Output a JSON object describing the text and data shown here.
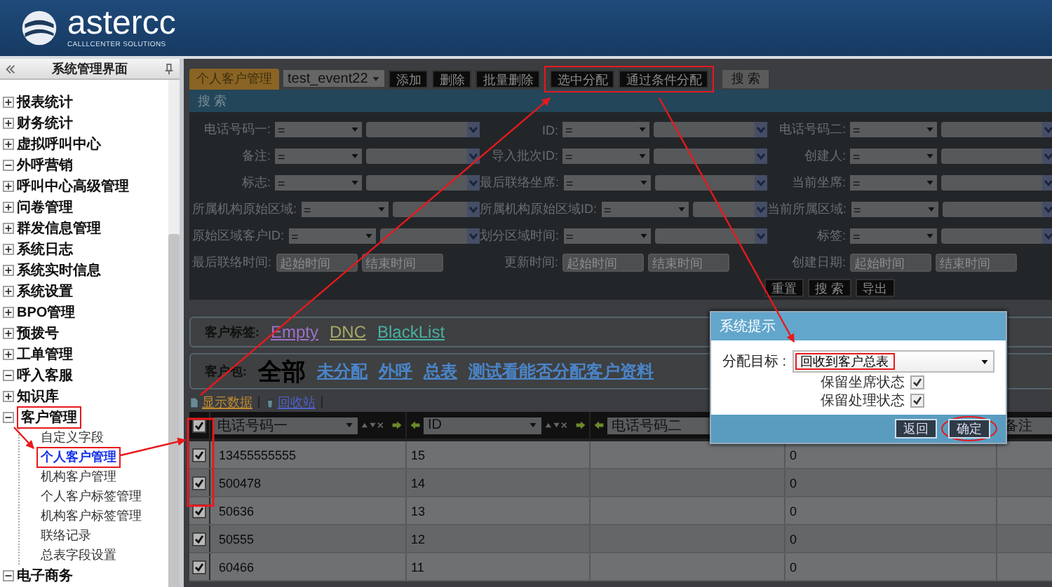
{
  "header": {
    "brand": "astercc",
    "tagline": "CALLLCENTER SOLUTIONS"
  },
  "sidebar": {
    "title": "系统管理界面",
    "items": [
      {
        "label": "报表统计",
        "expanded": false,
        "highlighted": false
      },
      {
        "label": "财务统计",
        "expanded": false,
        "highlighted": false
      },
      {
        "label": "虚拟呼叫中心",
        "expanded": false,
        "highlighted": false
      },
      {
        "label": "外呼营销",
        "expanded": true,
        "highlighted": false
      },
      {
        "label": "呼叫中心高级管理",
        "expanded": false,
        "highlighted": false
      },
      {
        "label": "问卷管理",
        "expanded": false,
        "highlighted": false
      },
      {
        "label": "群发信息管理",
        "expanded": false,
        "highlighted": false
      },
      {
        "label": "系统日志",
        "expanded": false,
        "highlighted": false
      },
      {
        "label": "系统实时信息",
        "expanded": false,
        "highlighted": false
      },
      {
        "label": "系统设置",
        "expanded": false,
        "highlighted": false
      },
      {
        "label": "BPO管理",
        "expanded": false,
        "highlighted": false
      },
      {
        "label": "预拨号",
        "expanded": false,
        "highlighted": false
      },
      {
        "label": "工单管理",
        "expanded": false,
        "highlighted": false
      },
      {
        "label": "呼入客服",
        "expanded": true,
        "highlighted": false
      },
      {
        "label": "知识库",
        "expanded": false,
        "highlighted": false
      },
      {
        "label": "客户管理",
        "expanded": true,
        "highlighted": true,
        "children": [
          {
            "label": "自定义字段",
            "selected": false
          },
          {
            "label": "个人客户管理",
            "selected": true
          },
          {
            "label": "机构客户管理",
            "selected": false
          },
          {
            "label": "个人客户标签管理",
            "selected": false
          },
          {
            "label": "机构客户标签管理",
            "selected": false
          },
          {
            "label": "联络记录",
            "selected": false
          },
          {
            "label": "总表字段设置",
            "selected": false
          }
        ]
      },
      {
        "label": "电子商务",
        "expanded": true,
        "highlighted": false
      }
    ]
  },
  "toolbar": {
    "tab": "个人客户管理",
    "event_select": "test_event22",
    "buttons": [
      {
        "label": "添加",
        "highlighted": false
      },
      {
        "label": "删除",
        "highlighted": false
      },
      {
        "label": "批量删除",
        "highlighted": false
      },
      {
        "label": "选中分配",
        "highlighted": true
      },
      {
        "label": "通过条件分配",
        "highlighted": true
      }
    ],
    "search_tab": "搜 索"
  },
  "search": {
    "title": "搜 索",
    "rows": [
      [
        {
          "label": "电话号码一:",
          "kind": "select",
          "operator": "="
        },
        {
          "label": "ID:",
          "kind": "select",
          "operator": "="
        },
        {
          "label": "电话号码二:",
          "kind": "select",
          "operator": "="
        }
      ],
      [
        {
          "label": "备注:",
          "kind": "select",
          "operator": "="
        },
        {
          "label": "导入批次ID:",
          "kind": "select",
          "operator": "="
        },
        {
          "label": "创建人:",
          "kind": "select",
          "operator": "="
        }
      ],
      [
        {
          "label": "标志:",
          "kind": "select",
          "operator": "="
        },
        {
          "label": "最后联络坐席:",
          "kind": "select",
          "operator": "="
        },
        {
          "label": "当前坐席:",
          "kind": "select",
          "operator": "="
        }
      ],
      [
        {
          "label": "所属机构原始区域:",
          "kind": "select",
          "operator": "="
        },
        {
          "label": "所属机构原始区域ID:",
          "kind": "select",
          "operator": "="
        },
        {
          "label": "当前所属区域:",
          "kind": "select",
          "operator": "="
        }
      ],
      [
        {
          "label": "原始区域客户ID:",
          "kind": "select",
          "operator": "="
        },
        {
          "label": "划分区域时间:",
          "kind": "select",
          "operator": "="
        },
        {
          "label": "标签:",
          "kind": "select",
          "operator": "="
        }
      ],
      [
        {
          "label": "最后联络时间:",
          "kind": "range",
          "from_placeholder": "起始时间",
          "to_placeholder": "结束时间"
        },
        {
          "label": "更新时间:",
          "kind": "range",
          "from_placeholder": "起始时间",
          "to_placeholder": "结束时间"
        },
        {
          "label": "创建日期:",
          "kind": "range",
          "from_placeholder": "起始时间",
          "to_placeholder": "结束时间"
        }
      ]
    ],
    "buttons": [
      "重置",
      "搜 索",
      "导出"
    ]
  },
  "tags": {
    "label": "客户标签:",
    "items": [
      {
        "label": "Empty",
        "color": "#a070c8"
      },
      {
        "label": "DNC",
        "color": "#a8a868"
      },
      {
        "label": "BlackList",
        "color": "#48b0a0"
      }
    ]
  },
  "packages": {
    "label": "客户包:",
    "items": [
      {
        "label": "全部",
        "selected": true
      },
      {
        "label": "未分配",
        "selected": false
      },
      {
        "label": "外呼",
        "selected": false
      },
      {
        "label": "总表",
        "selected": false
      },
      {
        "label": "测试看能否分配客户资料",
        "selected": false
      }
    ]
  },
  "links": [
    "显示数据",
    "回收站"
  ],
  "table": {
    "all_checked": true,
    "columns": [
      "电话号码一",
      "ID",
      "电话号码二",
      "备注"
    ],
    "rows": [
      {
        "checked": true,
        "phone_1": "13455555555",
        "id": "15",
        "column_4": "0"
      },
      {
        "checked": true,
        "phone_1": "500478",
        "id": "14",
        "column_4": "0"
      },
      {
        "checked": true,
        "phone_1": "50636",
        "id": "13",
        "column_4": "0"
      },
      {
        "checked": true,
        "phone_1": "50555",
        "id": "12",
        "column_4": "0"
      },
      {
        "checked": true,
        "phone_1": "60466",
        "id": "11",
        "column_4": "0"
      }
    ]
  },
  "dialog": {
    "title": "系统提示",
    "target_label": "分配目标 :",
    "target_value": "回收到客户总表",
    "options": [
      {
        "label": "保留坐席状态",
        "checked": true
      },
      {
        "label": "保留处理状态",
        "checked": true
      }
    ],
    "buttons": [
      "返回",
      "确定"
    ]
  }
}
